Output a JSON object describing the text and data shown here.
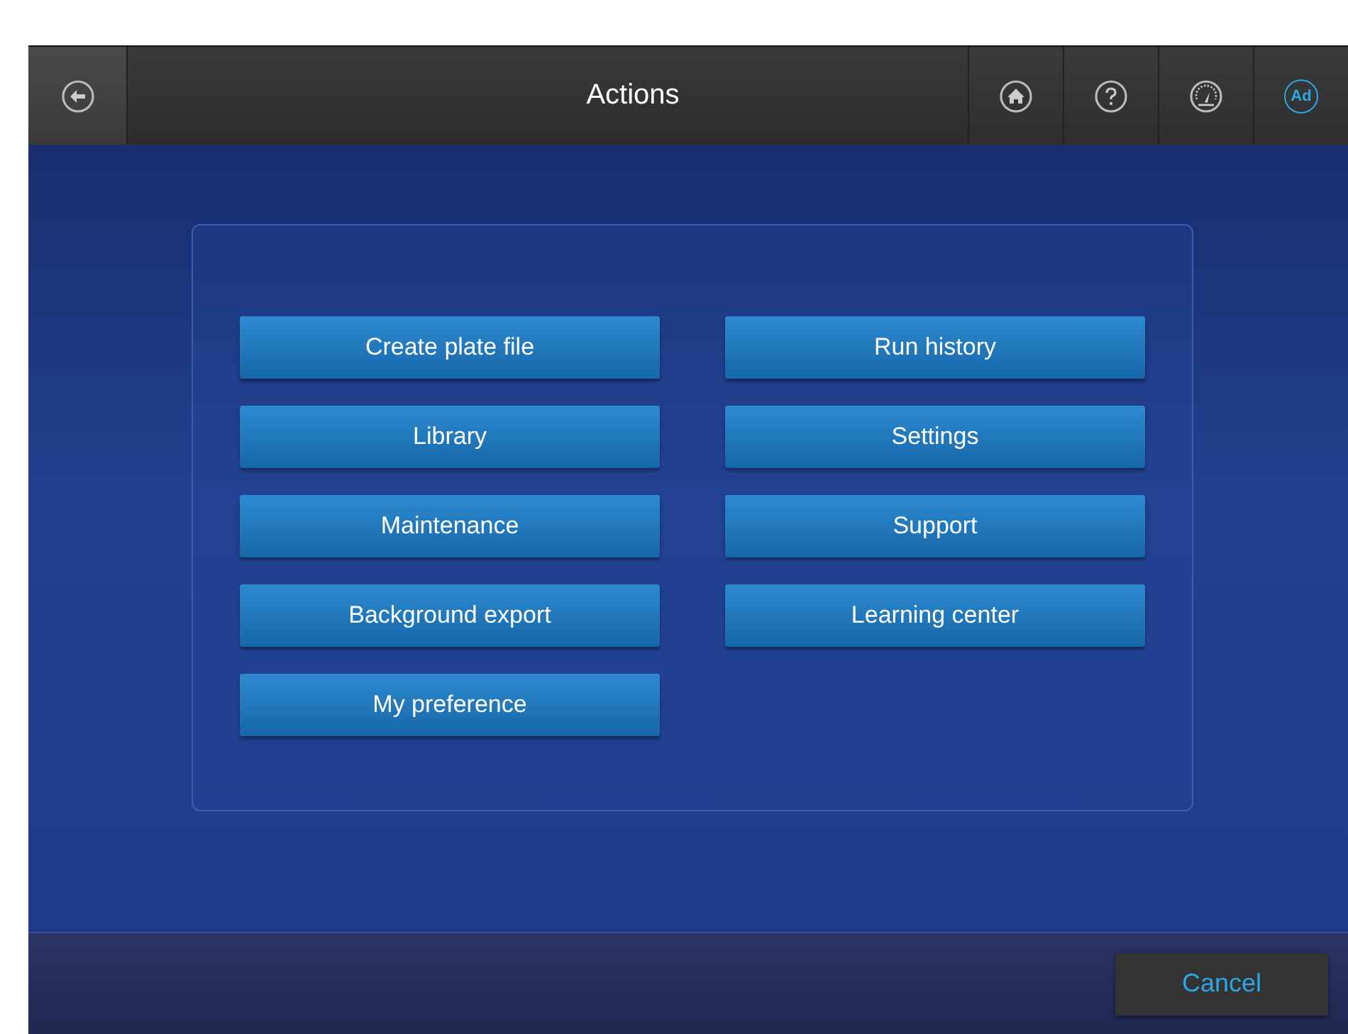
{
  "header": {
    "title": "Actions",
    "user_badge": "Ad"
  },
  "actions": [
    {
      "label": "Create plate file"
    },
    {
      "label": "Run history"
    },
    {
      "label": "Library"
    },
    {
      "label": "Settings"
    },
    {
      "label": "Maintenance"
    },
    {
      "label": "Support"
    },
    {
      "label": "Background export"
    },
    {
      "label": "Learning center"
    },
    {
      "label": "My preference"
    }
  ],
  "footer": {
    "cancel": "Cancel"
  }
}
